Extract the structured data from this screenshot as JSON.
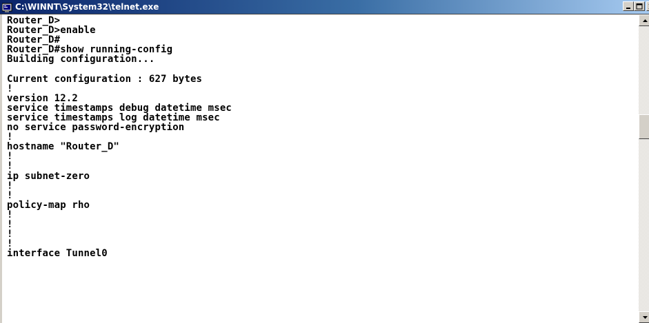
{
  "window": {
    "title": "C:\\WINNT\\System32\\telnet.exe"
  },
  "terminal": {
    "lines": [
      "Router_D>",
      "Router_D>enable",
      "Router_D#",
      "Router_D#show running-config",
      "Building configuration...",
      "",
      "Current configuration : 627 bytes",
      "!",
      "version 12.2",
      "service timestamps debug datetime msec",
      "service timestamps log datetime msec",
      "no service password-encryption",
      "!",
      "hostname \"Router_D\"",
      "!",
      "!",
      "ip subnet-zero",
      "!",
      "!",
      "policy-map rho",
      "!",
      "!",
      "!",
      "!",
      "interface Tunnel0"
    ]
  },
  "icons": {
    "app": "console-icon",
    "minimize": "minimize-icon",
    "maximize": "maximize-icon",
    "close": "close-icon",
    "scroll_up": "arrow-up-icon",
    "scroll_down": "arrow-down-icon"
  },
  "colors": {
    "titlebar_start": "#0a246a",
    "titlebar_end": "#a6caf0",
    "terminal_background": "#ffffff",
    "terminal_text": "#000000",
    "chrome": "#d4d0c8"
  },
  "scrollbar": {
    "position_fraction": 0.35
  }
}
